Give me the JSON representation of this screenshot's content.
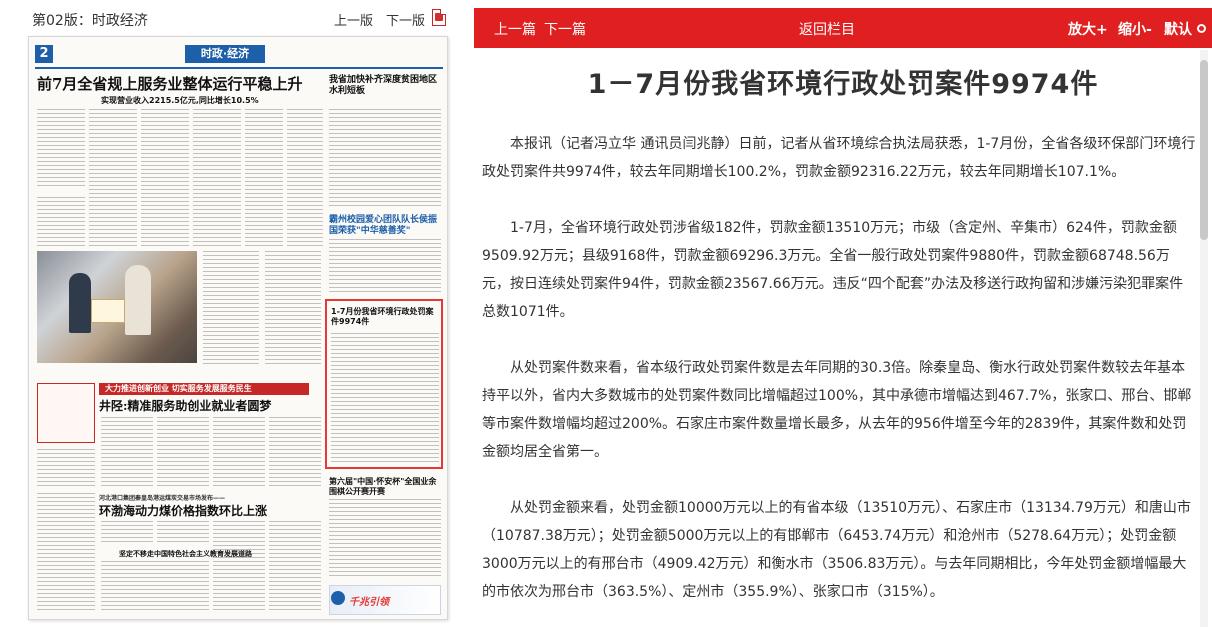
{
  "left_panel": {
    "edition_title": "第02版：时政经济",
    "prev_page": "上一版",
    "next_page": "下一版"
  },
  "paper": {
    "page_number": "2",
    "section_banner": "时政·经济",
    "lead_headline": "前7月全省规上服务业整体运行平稳上升",
    "lead_subheadline": "实现营业收入2215.5亿元,同比增长10.5%",
    "right_headline_1": "我省加快补齐深度贫困地区水利短板",
    "right_headline_2": "霸州校园爱心团队队长侯振国荣获\"中华慈善奖\"",
    "red_banner": "大力推进创新创业 切实服务发展服务民生",
    "second_headline": "井陉:精准服务助创业就业者圆梦",
    "highlighted_headline": "1-7月份我省环境行政处罚案件9974件",
    "third_kicker": "河北港口集团秦皇岛港运煤炭交易市场发布——",
    "third_headline": "环渤海动力煤价格指数环比上涨",
    "right_headline_3": "第六届\"中国·怀安杯\"全国业余围棋公开赛开赛",
    "fourth_headline": "坚定不移走中国特色社会主义教育发展道路",
    "ad_text": "千兆引领"
  },
  "toolbar": {
    "prev_article": "上一篇",
    "next_article": "下一篇",
    "back": "返回栏目",
    "zoom_in": "放大+",
    "zoom_out": "缩小-",
    "default": "默认"
  },
  "article": {
    "title": "1－7月份我省环境行政处罚案件9974件",
    "paragraphs": [
      "本报讯（记者冯立华 通讯员闫兆静）日前，记者从省环境综合执法局获悉，1-7月份，全省各级环保部门环境行政处罚案件共9974件，较去年同期增长100.2%，罚款金额92316.22万元，较去年同期增长107.1%。",
      "1-7月，全省环境行政处罚涉省级182件，罚款金额13510万元；市级（含定州、辛集市）624件，罚款金额9509.92万元；县级9168件，罚款金额69296.3万元。全省一般行政处罚案件9880件，罚款金额68748.56万元，按日连续处罚案件94件，罚款金额23567.66万元。违反“四个配套”办法及移送行政拘留和涉嫌污染犯罪案件总数1071件。",
      "从处罚案件数来看，省本级行政处罚案件数是去年同期的30.3倍。除秦皇岛、衡水行政处罚案件数较去年基本持平以外，省内大多数城市的处罚案件数同比增幅超过100%，其中承德市增幅达到467.7%，张家口、邢台、邯郸等市案件数增幅均超过200%。石家庄市案件数量增长最多，从去年的956件增至今年的2839件，其案件数和处罚金额均居全省第一。",
      "从处罚金额来看，处罚金额10000万元以上的有省本级（13510万元）、石家庄市（13134.79万元）和唐山市（10787.38万元）；处罚金额5000万元以上的有邯郸市（6453.74万元）和沧州市（5278.64万元）；处罚金额3000万元以上的有邢台市（4909.42万元）和衡水市（3506.83万元）。与去年同期相比，今年处罚金额增幅最大的市依次为邢台市（363.5%）、定州市（355.9%）、张家口市（315%）。"
    ]
  },
  "colors": {
    "toolbar_red": "#e02020",
    "paper_blue": "#1d5fa8",
    "highlight_red": "#e53935"
  }
}
